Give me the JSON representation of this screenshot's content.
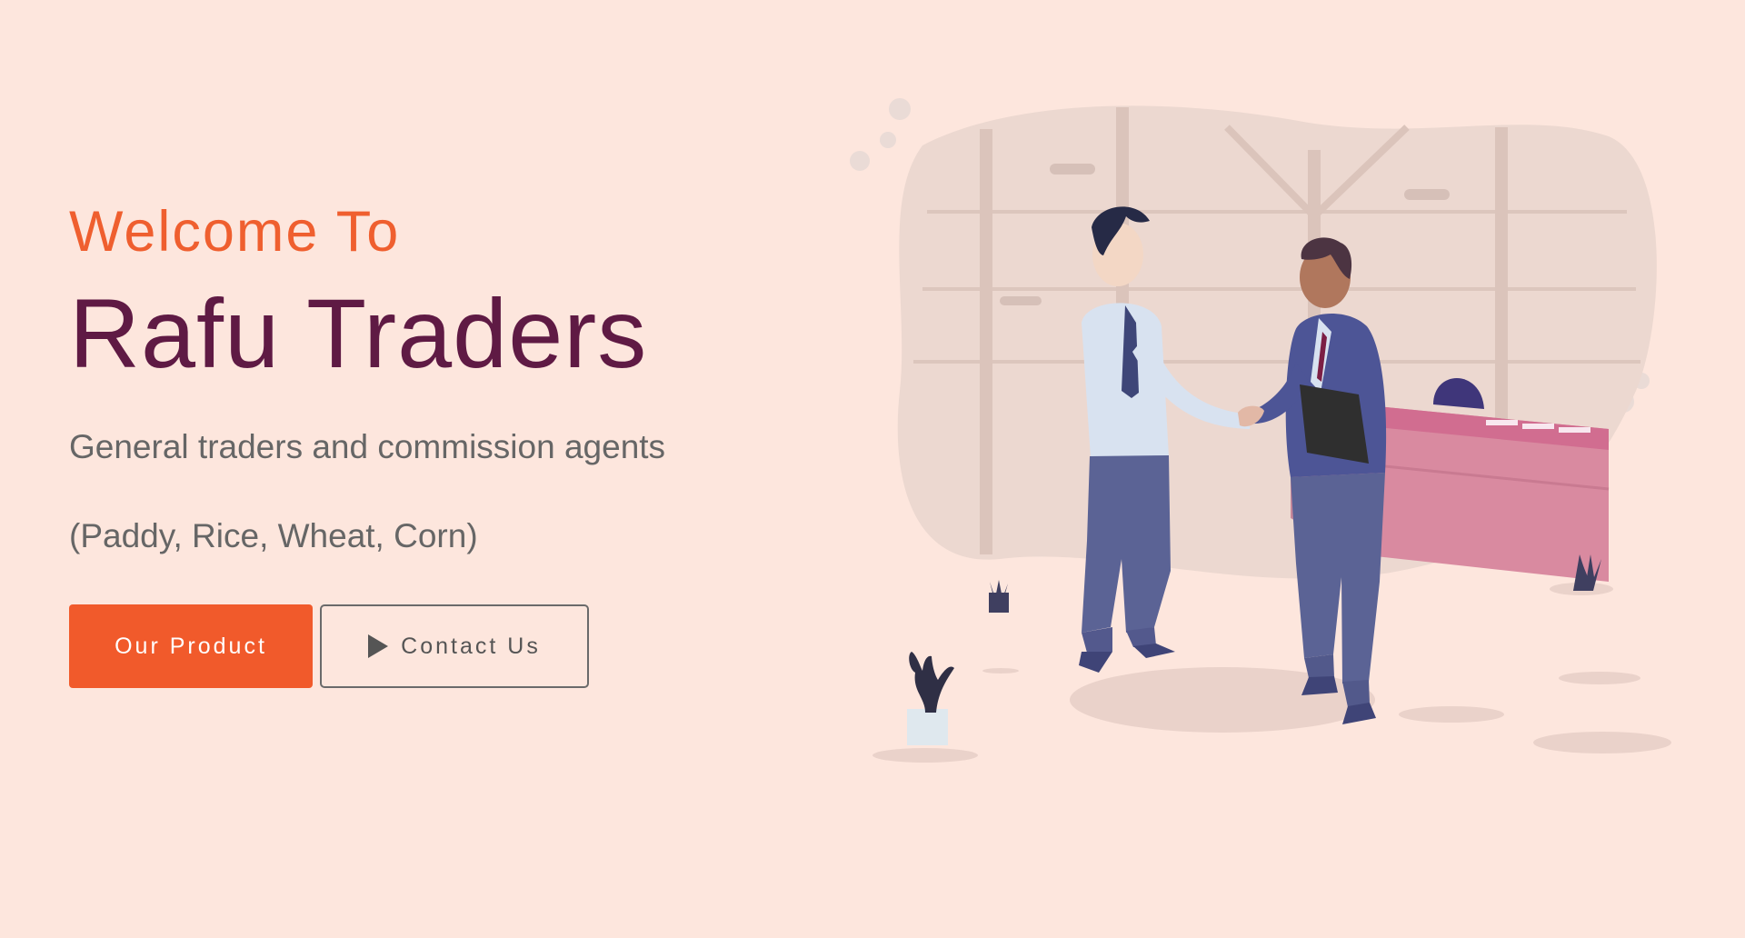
{
  "hero": {
    "welcome": "Welcome To",
    "brand": "Rafu Traders",
    "tagline": "General traders and commission agents",
    "products": "(Paddy, Rice, Wheat, Corn)"
  },
  "actions": {
    "primary_label": "Our Product",
    "secondary_label": "Contact Us",
    "secondary_icon": "play-icon"
  },
  "colors": {
    "background": "#fde6dd",
    "accent": "#f15a2b",
    "brand": "#5f1a44",
    "muted_text": "#666666"
  },
  "illustration": {
    "icon": "business-handshake-illustration"
  }
}
